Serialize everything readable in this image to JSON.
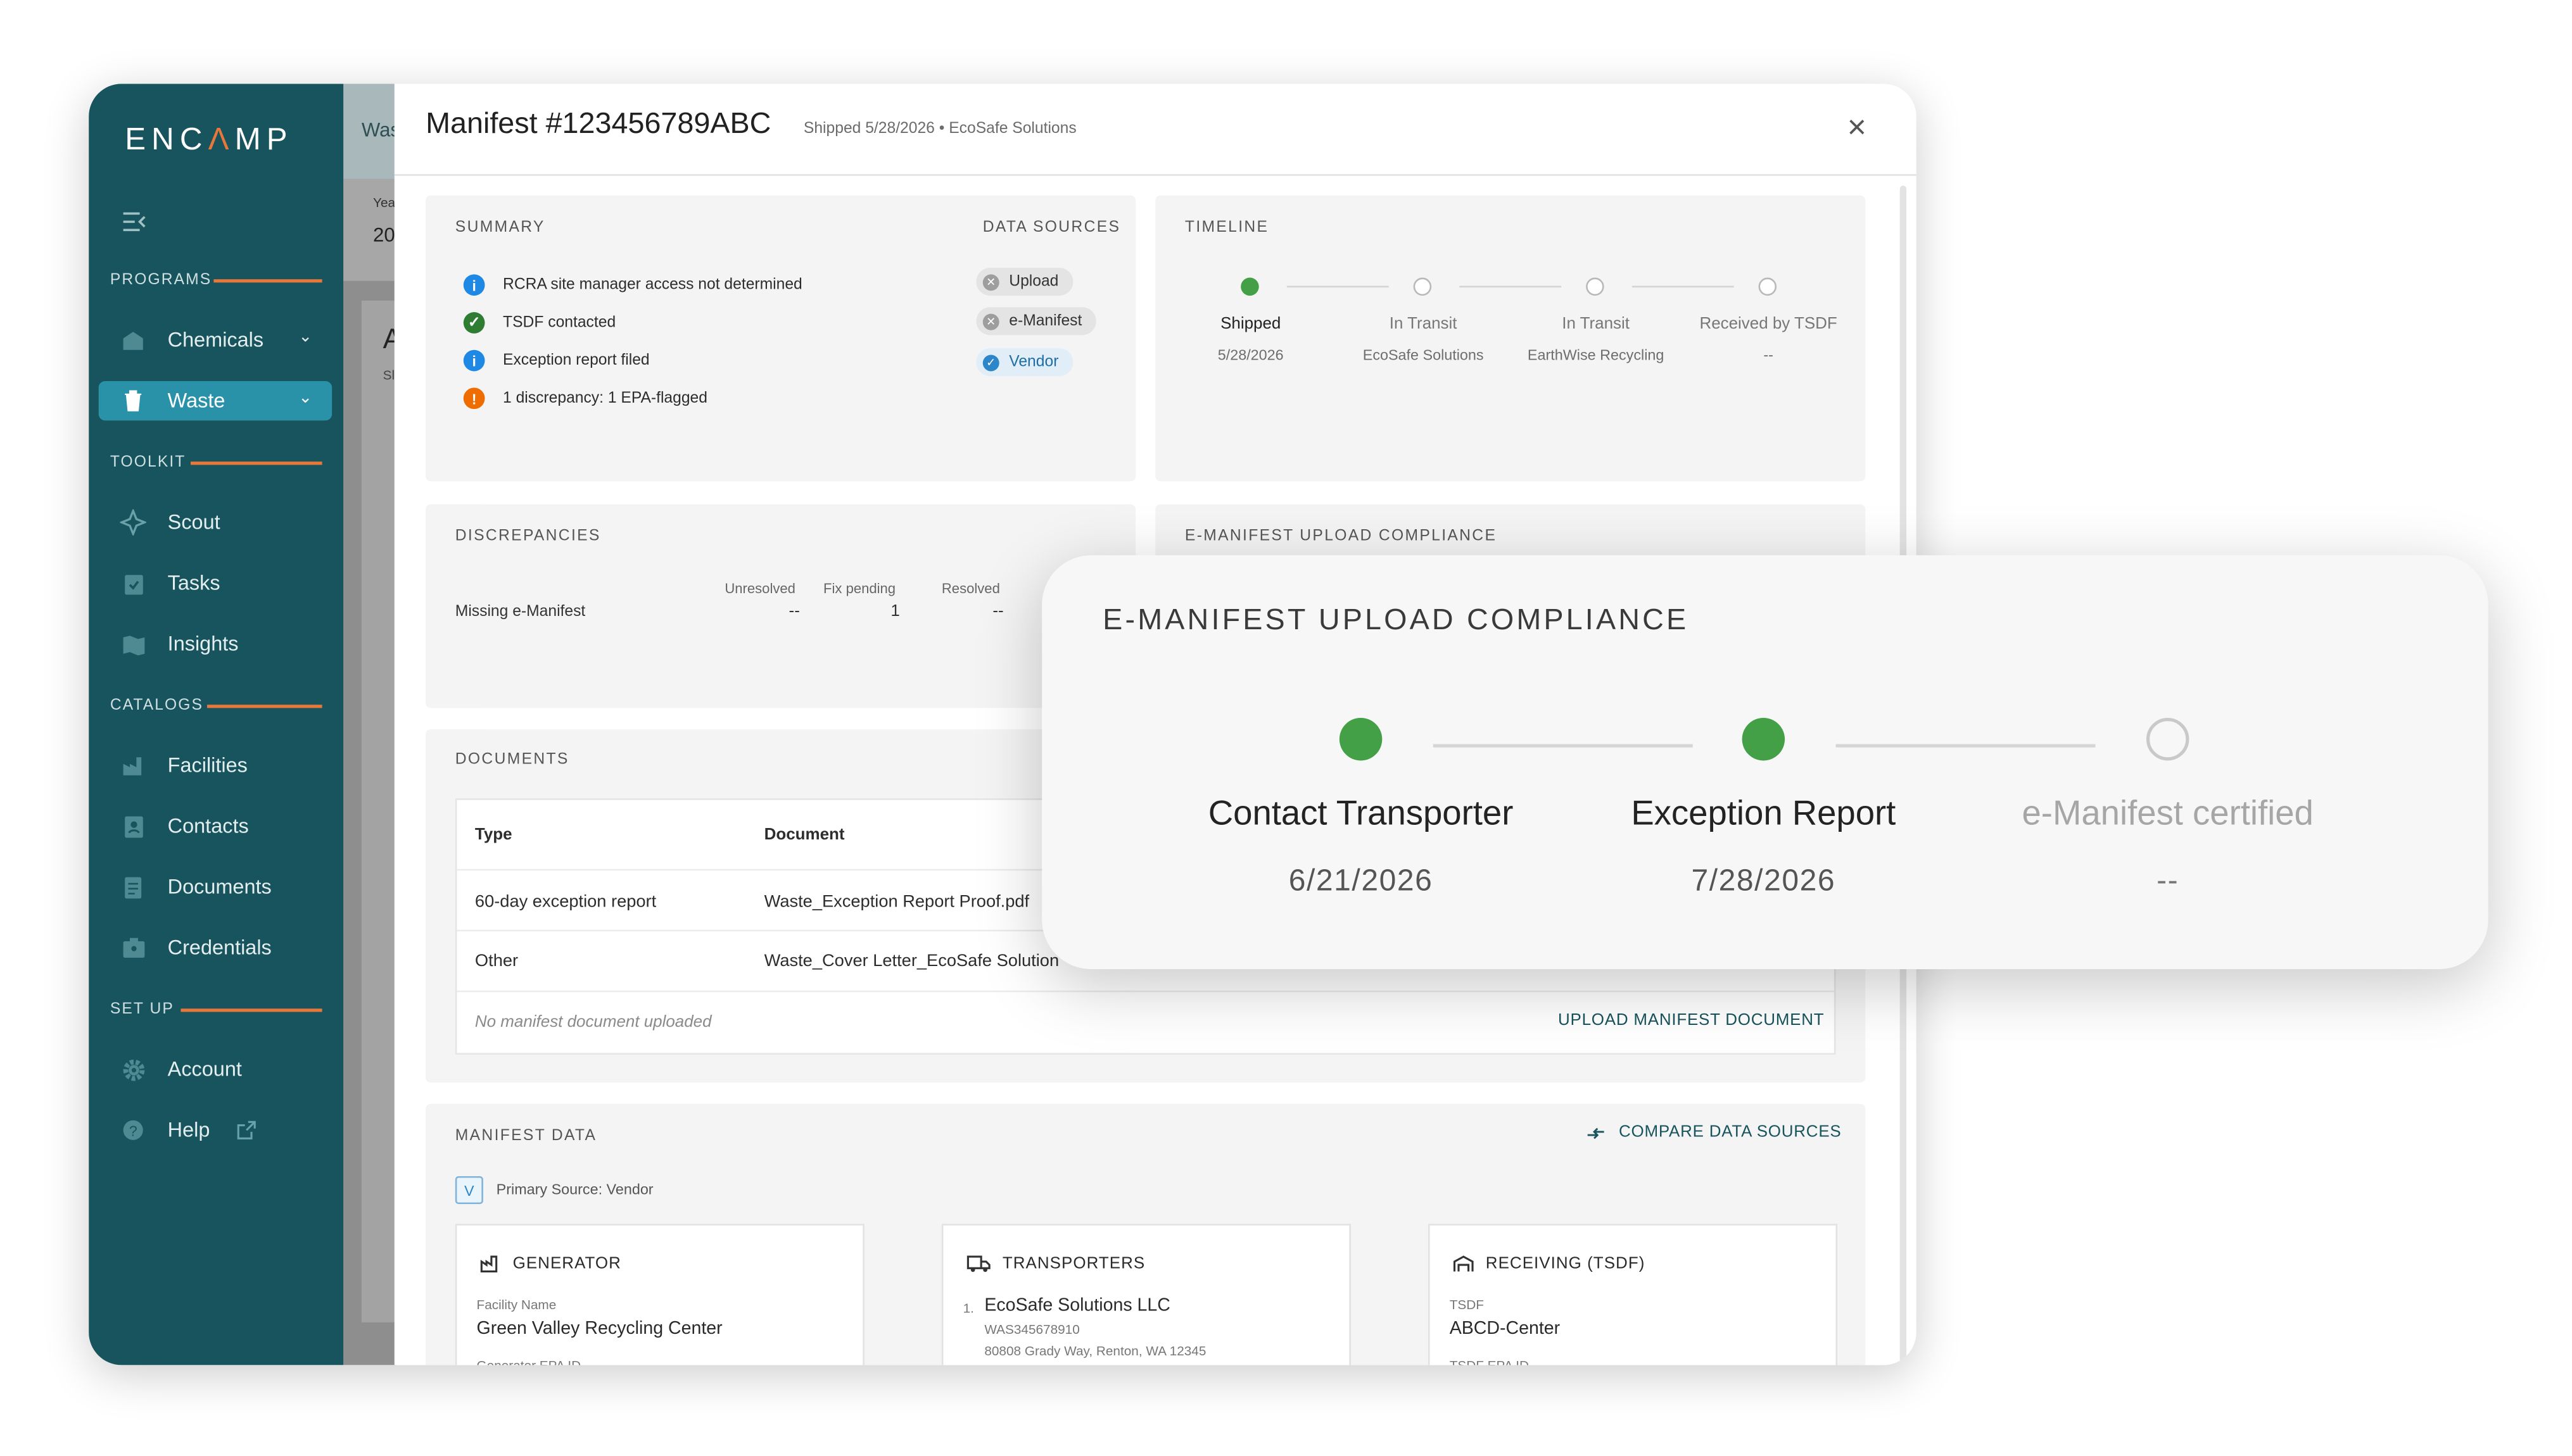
{
  "app": {
    "logo_pre": "ENC",
    "logo_accent": "Λ",
    "logo_post": "MP",
    "sections": {
      "programs": "PROGRAMS",
      "toolkit": "TOOLKIT",
      "catalogs": "CATALOGS",
      "setup": "SET UP"
    },
    "nav": {
      "chemicals": "Chemicals",
      "waste": "Waste",
      "scout": "Scout",
      "tasks": "Tasks",
      "insights": "Insights",
      "facilities": "Facilities",
      "contacts": "Contacts",
      "documents": "Documents",
      "credentials": "Credentials",
      "account": "Account",
      "help": "Help"
    },
    "behind": {
      "tab": "Was",
      "year_label": "Yea",
      "year_value": "20",
      "letter": "A",
      "small": "Sl"
    },
    "colors": {
      "sidebar": "#17545d",
      "accent": "#e8773a",
      "active": "#2a92a8",
      "success": "#43a047",
      "info": "#1e88e5",
      "warning": "#ef6c00",
      "link": "#17545d"
    }
  },
  "modal": {
    "title": "Manifest #123456789ABC",
    "subtitle": "Shipped 5/28/2026 • EcoSafe Solutions",
    "close": "×",
    "summary": {
      "title": "SUMMARY",
      "items": [
        {
          "status": "info",
          "icon": "i",
          "text": "RCRA site manager access not determined"
        },
        {
          "status": "success",
          "icon": "✓",
          "text": "TSDF contacted"
        },
        {
          "status": "info",
          "icon": "i",
          "text": "Exception report filed"
        },
        {
          "status": "warning",
          "icon": "!",
          "text": "1 discrepancy: 1 EPA-flagged"
        }
      ],
      "sources_title": "DATA SOURCES",
      "sources": [
        {
          "label": "Upload",
          "icon": "✕",
          "state": "unavailable"
        },
        {
          "label": "e-Manifest",
          "icon": "✕",
          "state": "unavailable"
        },
        {
          "label": "Vendor",
          "icon": "✓",
          "state": "selected"
        }
      ]
    },
    "timeline": {
      "title": "TIMELINE",
      "steps": [
        {
          "label": "Shipped",
          "sub": "5/28/2026",
          "state": "done"
        },
        {
          "label": "In Transit",
          "sub": "EcoSafe Solutions",
          "state": "pending"
        },
        {
          "label": "In Transit",
          "sub": "EarthWise Recycling",
          "state": "pending"
        },
        {
          "label": "Received by TSDF",
          "sub": "--",
          "state": "pending"
        }
      ]
    },
    "discrepancies": {
      "title": "DISCREPANCIES",
      "columns": [
        "Unresolved",
        "Fix pending",
        "Resolved"
      ],
      "rows": [
        {
          "name": "Missing e-Manifest",
          "values": [
            "--",
            "1",
            "--"
          ]
        }
      ]
    },
    "emanifest_header": "E-MANIFEST UPLOAD COMPLIANCE",
    "documents": {
      "title": "DOCUMENTS",
      "columns": [
        "Type",
        "Document"
      ],
      "rows": [
        {
          "type": "60-day exception report",
          "document": "Waste_Exception Report Proof.pdf"
        },
        {
          "type": "Other",
          "document": "Waste_Cover Letter_EcoSafe Solution"
        }
      ],
      "empty_note": "No manifest document uploaded",
      "upload_action": "UPLOAD MANIFEST DOCUMENT"
    },
    "manifest_data": {
      "title": "MANIFEST DATA",
      "compare_action": "COMPARE DATA SOURCES",
      "primary_badge": "V",
      "primary_source": "Primary Source: Vendor",
      "generator": {
        "title": "GENERATOR",
        "field_label": "Facility Name",
        "field_value": "Green Valley Recycling Center",
        "cut_label": "Generator EPA ID"
      },
      "transporters": {
        "title": "TRANSPORTERS",
        "index": "1.",
        "name": "EcoSafe Solutions LLC",
        "id": "WAS345678910",
        "address": "80808 Grady Way, Renton, WA 12345"
      },
      "receiving": {
        "title": "RECEIVING (TSDF)",
        "field_label": "TSDF",
        "field_value": "ABCD-Center",
        "cut_label": "TSDF EPA ID"
      }
    }
  },
  "overlay": {
    "title": "E-MANIFEST UPLOAD COMPLIANCE",
    "steps": [
      {
        "label": "Contact Transporter",
        "date": "6/21/2026",
        "state": "done"
      },
      {
        "label": "Exception Report",
        "date": "7/28/2026",
        "state": "done"
      },
      {
        "label": "e-Manifest certified",
        "date": "--",
        "state": "pending"
      }
    ]
  }
}
